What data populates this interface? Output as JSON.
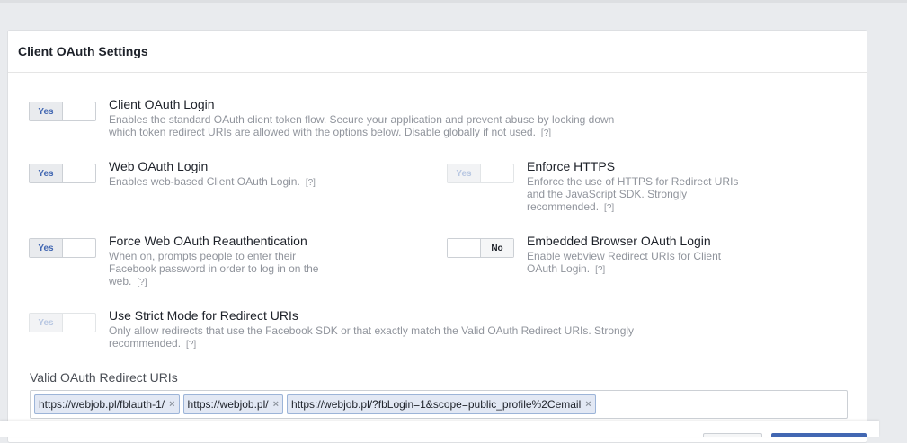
{
  "panel": {
    "title": "Client OAuth Settings"
  },
  "settings": {
    "client_oauth_login": {
      "toggle": "Yes",
      "title": "Client OAuth Login",
      "description": "Enables the standard OAuth client token flow. Secure your application and prevent abuse by locking down which token redirect URIs are allowed with the options below. Disable globally if not used.",
      "help": "[?]"
    },
    "web_oauth_login": {
      "toggle": "Yes",
      "title": "Web OAuth Login",
      "description": "Enables web-based Client OAuth Login.",
      "help": "[?]"
    },
    "enforce_https": {
      "toggle": "Yes",
      "title": "Enforce HTTPS",
      "description": "Enforce the use of HTTPS for Redirect URIs and the JavaScript SDK. Strongly recommended.",
      "help": "[?]"
    },
    "force_web_reauth": {
      "toggle": "Yes",
      "title": "Force Web OAuth Reauthentication",
      "description": "When on, prompts people to enter their Facebook password in order to log in on the web.",
      "help": "[?]"
    },
    "embedded_browser": {
      "toggle": "No",
      "title": "Embedded Browser OAuth Login",
      "description": "Enable webview Redirect URIs for Client OAuth Login.",
      "help": "[?]"
    },
    "strict_mode": {
      "toggle": "Yes",
      "title": "Use Strict Mode for Redirect URIs",
      "description": "Only allow redirects that use the Facebook SDK or that exactly match the Valid OAuth Redirect URIs. Strongly recommended.",
      "help": "[?]"
    }
  },
  "redirect_uris": {
    "label": "Valid OAuth Redirect URIs",
    "remove_glyph": "×",
    "items": [
      "https://webjob.pl/fblauth-1/",
      "https://webjob.pl/",
      "https://webjob.pl/?fbLogin=1&scope=public_profile%2Cemail"
    ]
  },
  "colors": {
    "accent": "#4267b2",
    "background": "#e9ebee",
    "muted_text": "#90949c"
  }
}
